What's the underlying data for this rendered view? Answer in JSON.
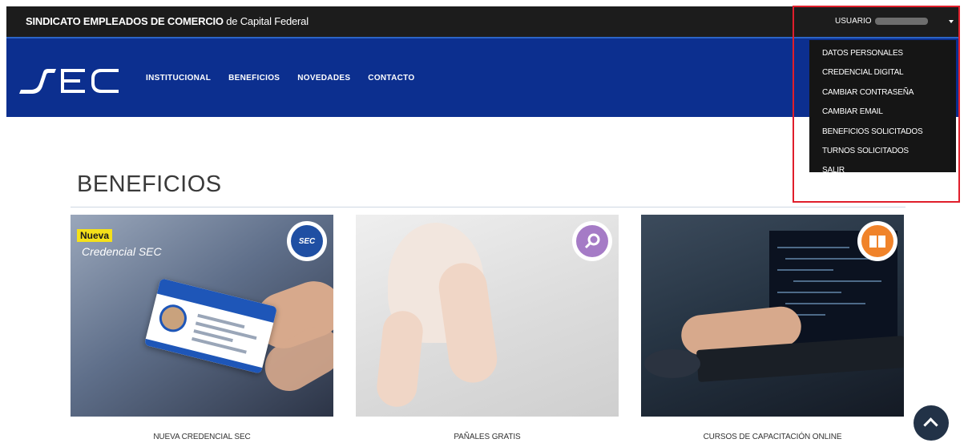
{
  "topbar": {
    "brand_bold": "SINDICATO EMPLEADOS DE COMERCIO",
    "brand_rest": " de Capital Federal",
    "user_label": "USUARIO"
  },
  "logo": {
    "text": "SEC"
  },
  "nav": {
    "items": [
      "INSTITUCIONAL",
      "BENEFICIOS",
      "NOVEDADES",
      "CONTACTO"
    ]
  },
  "user_menu": {
    "items": [
      "DATOS PERSONALES",
      "CREDENCIAL DIGITAL",
      "CAMBIAR CONTRASEÑA",
      "CAMBIAR EMAIL",
      "BENEFICIOS SOLICITADOS",
      "TURNOS SOLICITADOS",
      "SALIR"
    ]
  },
  "section": {
    "title": "BENEFICIOS"
  },
  "cards": [
    {
      "caption": "NUEVA CREDENCIAL SEC",
      "tag": "Nueva",
      "subtitle": "Credencial SEC",
      "badge": "SEC",
      "badge_color": "#1f4fa3"
    },
    {
      "caption": "PAÑALES GRATIS",
      "badge_color": "#a57bc6"
    },
    {
      "caption": "CURSOS DE CAPACITACIÓN ONLINE",
      "badge_color": "#f0832a"
    }
  ]
}
